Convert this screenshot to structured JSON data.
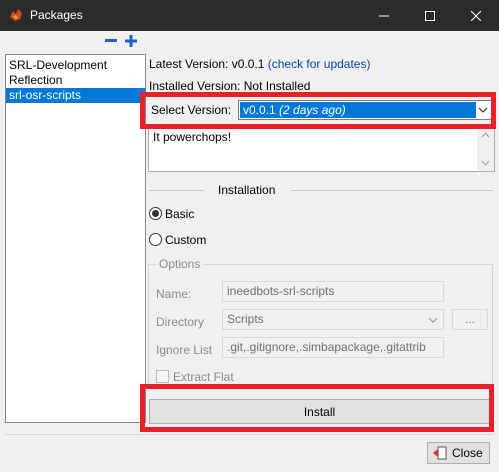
{
  "window": {
    "title": "Packages",
    "minimize_glyph": "—",
    "maximize_glyph": "☐",
    "close_glyph": "✕"
  },
  "package_list": {
    "items": [
      "SRL-Development",
      "Reflection",
      "srl-osr-scripts"
    ],
    "selected_index": 2
  },
  "details": {
    "latest_version_label": "Latest Version: v0.0.1",
    "check_updates_link": "(check for updates)",
    "installed_version_label": "Installed Version: Not Installed",
    "select_version_label": "Select Version:",
    "select_version_value": "v0.0.1",
    "select_version_age": "(2 days ago)",
    "description": "It powerchops!"
  },
  "installation": {
    "section_title": "Installation",
    "basic_label": "Basic",
    "custom_label": "Custom",
    "selected": "Basic"
  },
  "options": {
    "group_title": "Options",
    "name_label": "Name:",
    "name_value": "ineedbots-srl-scripts",
    "directory_label": "Directory",
    "directory_value": "Scripts",
    "browse_label": "...",
    "ignore_label": "Ignore List",
    "ignore_value": ".git,.gitignore,.simbapackage,.gitattrib",
    "extract_flat_label": "Extract Flat",
    "extract_flat_checked": false
  },
  "buttons": {
    "install_label": "Install",
    "close_label": "Close"
  },
  "colors": {
    "titlebar": "#2b2b2b",
    "selection": "#0078d7",
    "highlight_box": "#e8202a",
    "link": "#0645ad"
  }
}
